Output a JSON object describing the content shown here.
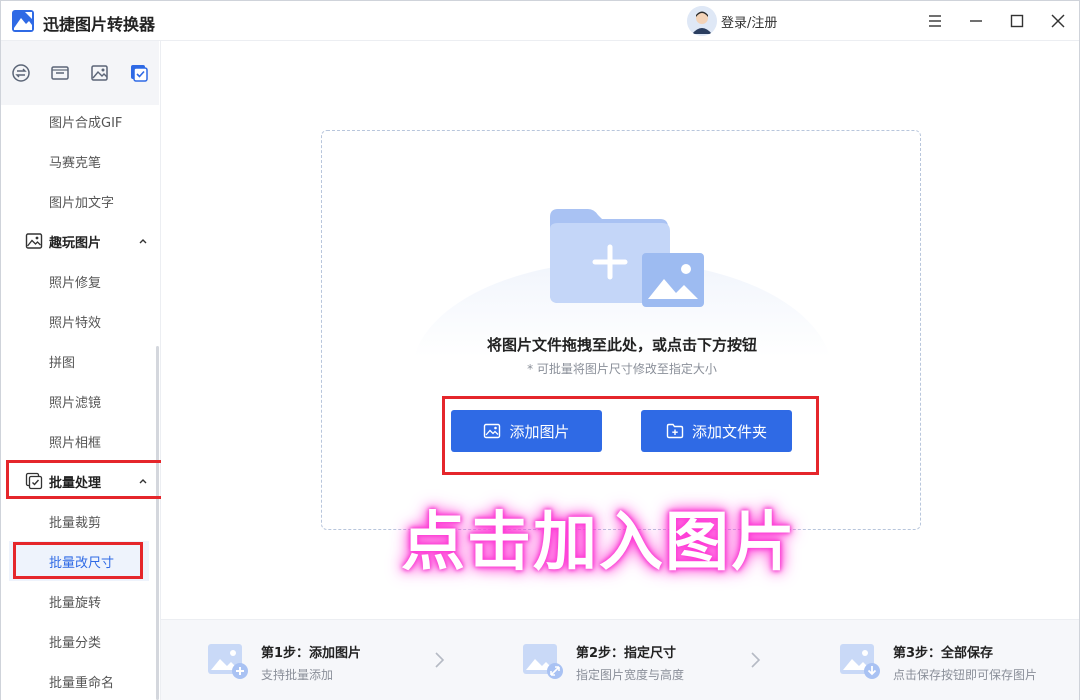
{
  "app": {
    "title": "迅捷图片转换器"
  },
  "header": {
    "login_label": "登录/注册"
  },
  "sidebar": {
    "tools": [
      {
        "icon": "convert-icon"
      },
      {
        "icon": "compress-icon"
      },
      {
        "icon": "image-edit-icon"
      },
      {
        "icon": "batch-icon"
      }
    ],
    "items_top": [
      "图片合成GIF",
      "马赛克笔",
      "图片加文字"
    ],
    "group_fun": {
      "label": "趣玩图片",
      "icon": "fun-image-icon"
    },
    "items_fun": [
      "照片修复",
      "照片特效",
      "拼图",
      "照片滤镜",
      "照片相框"
    ],
    "group_batch": {
      "label": "批量处理",
      "icon": "batch-process-icon"
    },
    "items_batch": [
      "批量裁剪",
      "批量改尺寸",
      "批量旋转",
      "批量分类",
      "批量重命名"
    ],
    "active_item": "批量改尺寸"
  },
  "dropzone": {
    "title": "将图片文件拖拽至此处，或点击下方按钮",
    "hint": "* 可批量将图片尺寸修改至指定大小",
    "add_image_label": "添加图片",
    "add_folder_label": "添加文件夹"
  },
  "overlay": {
    "caption": "点击加入图片"
  },
  "steps": [
    {
      "title": "第1步：添加图片",
      "desc": "支持批量添加"
    },
    {
      "title": "第2步：指定尺寸",
      "desc": "指定图片宽度与高度"
    },
    {
      "title": "第3步：全部保存",
      "desc": "点击保存按钮即可保存图片"
    }
  ],
  "colors": {
    "accent": "#2f6ae5",
    "highlight": "#e5262b",
    "glow": "#ff3bd7"
  }
}
